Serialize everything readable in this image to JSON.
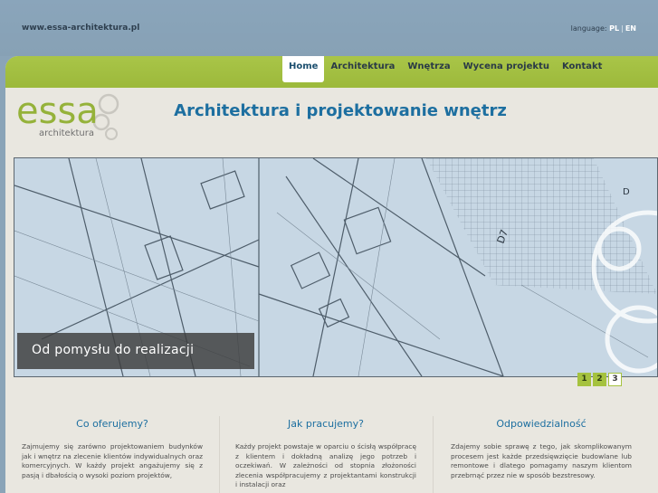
{
  "header": {
    "site_url": "www.essa-architektura.pl",
    "language_label": "language:",
    "lang_pl": "PL",
    "lang_sep": "|",
    "lang_en": "EN"
  },
  "nav": {
    "items": [
      {
        "label": "Home",
        "active": true
      },
      {
        "label": "Architektura"
      },
      {
        "label": "Wnętrza"
      },
      {
        "label": "Wycena projektu"
      },
      {
        "label": "Kontakt"
      }
    ]
  },
  "logo": {
    "main": "essa",
    "sub": "architektura"
  },
  "headline": "Architektura i projektowanie wnętrz",
  "slider": {
    "caption": "Od pomysłu do realizacji"
  },
  "pager": {
    "pages": [
      "1",
      "2",
      "3"
    ],
    "active": "3"
  },
  "columns": [
    {
      "title": "Co oferujemy?",
      "text": "Zajmujemy się zarówno projektowaniem budynków jak i wnętrz na zlecenie klientów indywidualnych oraz komercyjnych. W każdy projekt angażujemy się z pasją i dbałością o wysoki poziom projektów,"
    },
    {
      "title": "Jak pracujemy?",
      "text": "Każdy projekt powstaje w oparciu o ścisłą współpracę z klientem i dokładną analizę jego potrzeb i oczekiwań. W zależności od stopnia złożoności zlecenia współpracujemy z projektantami konstrukcji i instalacji oraz"
    },
    {
      "title": "Odpowiedzialność",
      "text": "Zdajemy sobie sprawę z tego, jak skomplikowanym procesem jest każde przedsięwzięcie budowlane lub remontowe i dlatego pomagamy naszym klientom przebrnąć przez nie w sposób bezstresowy."
    }
  ],
  "colors": {
    "accent_green": "#a5c23f",
    "title_blue": "#1d6fa0",
    "page_bg": "#e9e7e0",
    "top_bg": "#8aa4b8"
  }
}
